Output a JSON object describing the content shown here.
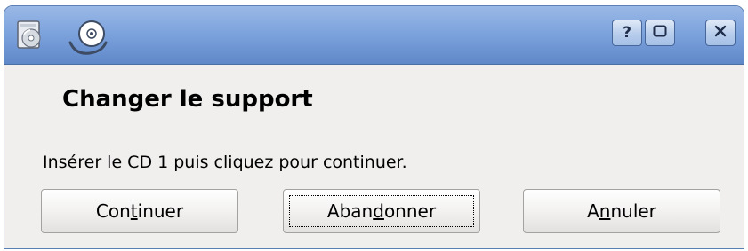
{
  "titlebar": {
    "app_icon": "cd-drive-icon",
    "cd_icon": "cd-disc-icon",
    "help_label": "?",
    "maximize_icon": "maximize-icon",
    "close_icon": "close-icon"
  },
  "dialog": {
    "heading": "Changer le support",
    "message": "Insérer le CD 1 puis cliquez pour continuer."
  },
  "buttons": {
    "continue": {
      "pre": "Con",
      "mnemonic": "t",
      "post": "inuer"
    },
    "abandon": {
      "pre": "Aban",
      "mnemonic": "d",
      "post": "onner"
    },
    "cancel": {
      "pre": "A",
      "mnemonic": "n",
      "post": "nuler"
    }
  },
  "colors": {
    "titlebar_top": "#9ab8e6",
    "titlebar_bottom": "#5f88c9",
    "window_bg": "#f0efee"
  }
}
